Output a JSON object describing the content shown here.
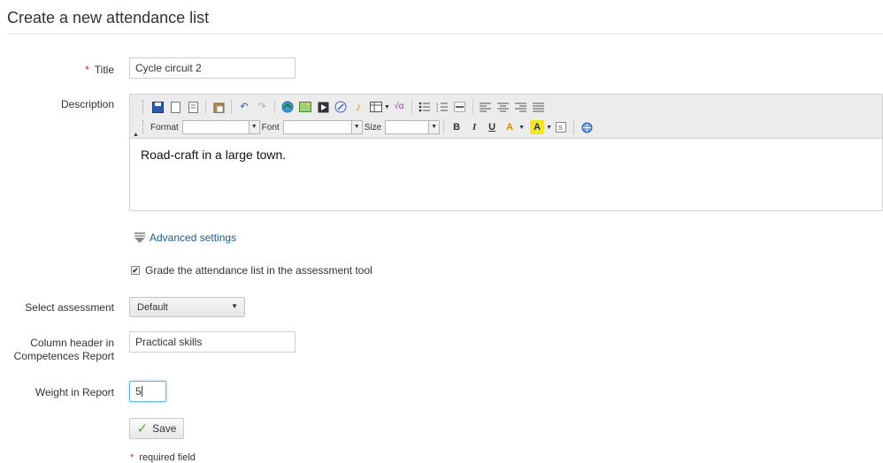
{
  "page": {
    "title": "Create a new attendance list"
  },
  "form": {
    "required_marker": "*",
    "title": {
      "label": "Title",
      "value": "Cycle circuit 2"
    },
    "description": {
      "label": "Description",
      "content": "Road-craft in a large town.",
      "toolbar": {
        "format_label": "Format",
        "font_label": "Font",
        "size_label": "Size",
        "bold": "B",
        "italic": "I",
        "underline": "U",
        "text_color": "A",
        "bg_color": "A"
      }
    },
    "advanced_settings": "Advanced settings",
    "grade_checkbox": {
      "label": "Grade the attendance list in the assessment tool",
      "checked": true
    },
    "select_assessment": {
      "label": "Select assessment",
      "value": "Default"
    },
    "column_header": {
      "label_line1": "Column header in",
      "label_line2": "Competences Report",
      "value": "Practical skills"
    },
    "weight": {
      "label": "Weight in Report",
      "value": "5"
    },
    "save_label": "Save",
    "required_note": "required field"
  },
  "colors": {
    "required": "#c9302c",
    "link": "#1a5d96",
    "save_check": "#4aa72a"
  }
}
